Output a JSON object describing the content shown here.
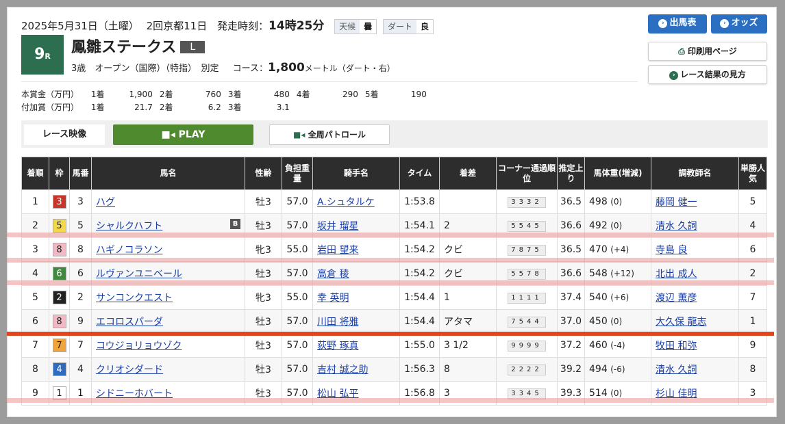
{
  "header": {
    "date": "2025年5月31日（土曜）",
    "meeting": "2回京都11日",
    "start_label": "発走時刻：",
    "start_time": "14時25分",
    "weather_label": "天候",
    "weather_value": "曇",
    "track_label": "ダート",
    "track_value": "良"
  },
  "race": {
    "number": "9",
    "number_suffix": "R",
    "name": "鳳雛ステークス",
    "grade": "L",
    "conditions": "3歳　オープン（国際）（特指）　別定",
    "course_label": "コース：",
    "distance": "1,800",
    "course_detail": "メートル（ダート・右）"
  },
  "prizes": {
    "main_label": "本賞金（万円）",
    "main": [
      [
        "1着",
        "1,900"
      ],
      [
        "2着",
        "760"
      ],
      [
        "3着",
        "480"
      ],
      [
        "4着",
        "290"
      ],
      [
        "5着",
        "190"
      ]
    ],
    "add_label": "付加賞（万円）",
    "add": [
      [
        "1着",
        "21.7"
      ],
      [
        "2着",
        "6.2"
      ],
      [
        "3着",
        "3.1"
      ]
    ]
  },
  "buttons": {
    "entries": "出馬表",
    "odds": "オッズ",
    "print": "印刷用ページ",
    "guide": "レース結果の見方"
  },
  "video": {
    "label": "レース映像",
    "play": "PLAY",
    "patrol": "全周パトロール"
  },
  "table": {
    "headers": [
      "着順",
      "枠",
      "馬番",
      "馬名",
      "性齢",
      "負担重量",
      "騎手名",
      "タイム",
      "着差",
      "コーナー通過順位",
      "推定上り",
      "馬体重(増減)",
      "調教師名",
      "単勝人気"
    ],
    "rows": [
      {
        "pos": "1",
        "waku": "3",
        "num": "3",
        "horse": "ハグ",
        "blinker": "",
        "sexage": "牡3",
        "weight": "57.0",
        "jockey": "A.シュタルケ",
        "time": "1:53.8",
        "margin": "",
        "corner": "3332",
        "last": "36.5",
        "bw": "498",
        "bwd": "(0)",
        "trainer": "藤岡 健一",
        "pop": "5"
      },
      {
        "pos": "2",
        "waku": "5",
        "num": "5",
        "horse": "シャルクハフト",
        "blinker": "B",
        "sexage": "牡3",
        "weight": "57.0",
        "jockey": "坂井 瑠星",
        "time": "1:54.1",
        "margin": "2",
        "corner": "5545",
        "last": "36.6",
        "bw": "492",
        "bwd": "(0)",
        "trainer": "清水 久詞",
        "pop": "4"
      },
      {
        "pos": "3",
        "waku": "8",
        "num": "8",
        "horse": "ハギノコラソン",
        "blinker": "",
        "sexage": "牝3",
        "weight": "55.0",
        "jockey": "岩田 望来",
        "time": "1:54.2",
        "margin": "クビ",
        "corner": "7875",
        "last": "36.5",
        "bw": "470",
        "bwd": "(+4)",
        "trainer": "寺島 良",
        "pop": "6"
      },
      {
        "pos": "4",
        "waku": "6",
        "num": "6",
        "horse": "ルヴァンユニベール",
        "blinker": "",
        "sexage": "牡3",
        "weight": "57.0",
        "jockey": "高倉 稜",
        "time": "1:54.2",
        "margin": "クビ",
        "corner": "5578",
        "last": "36.6",
        "bw": "548",
        "bwd": "(+12)",
        "trainer": "北出 成人",
        "pop": "2"
      },
      {
        "pos": "5",
        "waku": "2",
        "num": "2",
        "horse": "サンコンクエスト",
        "blinker": "",
        "sexage": "牝3",
        "weight": "55.0",
        "jockey": "幸 英明",
        "time": "1:54.4",
        "margin": "1",
        "corner": "1111",
        "last": "37.4",
        "bw": "540",
        "bwd": "(+6)",
        "trainer": "渡辺 薫彦",
        "pop": "7"
      },
      {
        "pos": "6",
        "waku": "8",
        "num": "9",
        "horse": "エコロスパーダ",
        "blinker": "",
        "sexage": "牡3",
        "weight": "57.0",
        "jockey": "川田 将雅",
        "time": "1:54.4",
        "margin": "アタマ",
        "corner": "7544",
        "last": "37.0",
        "bw": "450",
        "bwd": "(0)",
        "trainer": "大久保 龍志",
        "pop": "1"
      },
      {
        "pos": "7",
        "waku": "7",
        "num": "7",
        "horse": "コウジョリョウゾク",
        "blinker": "",
        "sexage": "牡3",
        "weight": "57.0",
        "jockey": "荻野 琢真",
        "time": "1:55.0",
        "margin": "3 1/2",
        "corner": "9999",
        "last": "37.2",
        "bw": "460",
        "bwd": "(-4)",
        "trainer": "牧田 和弥",
        "pop": "9"
      },
      {
        "pos": "8",
        "waku": "4",
        "num": "4",
        "horse": "クリオシダード",
        "blinker": "",
        "sexage": "牡3",
        "weight": "57.0",
        "jockey": "吉村 誠之助",
        "time": "1:56.3",
        "margin": "8",
        "corner": "2222",
        "last": "39.2",
        "bw": "494",
        "bwd": "(-6)",
        "trainer": "清水 久詞",
        "pop": "8"
      },
      {
        "pos": "9",
        "waku": "1",
        "num": "1",
        "horse": "シドニーホバート",
        "blinker": "",
        "sexage": "牡3",
        "weight": "57.0",
        "jockey": "松山 弘平",
        "time": "1:56.8",
        "margin": "3",
        "corner": "3345",
        "last": "39.3",
        "bw": "514",
        "bwd": "(0)",
        "trainer": "杉山 佳明",
        "pop": "3"
      }
    ]
  },
  "waku_colors": {
    "1": [
      "#ffffff",
      "#222"
    ],
    "2": [
      "#222222",
      "#fff"
    ],
    "3": [
      "#c8352b",
      "#fff"
    ],
    "4": [
      "#2f6cc0",
      "#fff"
    ],
    "5": [
      "#f3d94a",
      "#222"
    ],
    "6": [
      "#3f8a3f",
      "#fff"
    ],
    "7": [
      "#f0a43a",
      "#222"
    ],
    "8": [
      "#f2b9c4",
      "#222"
    ]
  }
}
